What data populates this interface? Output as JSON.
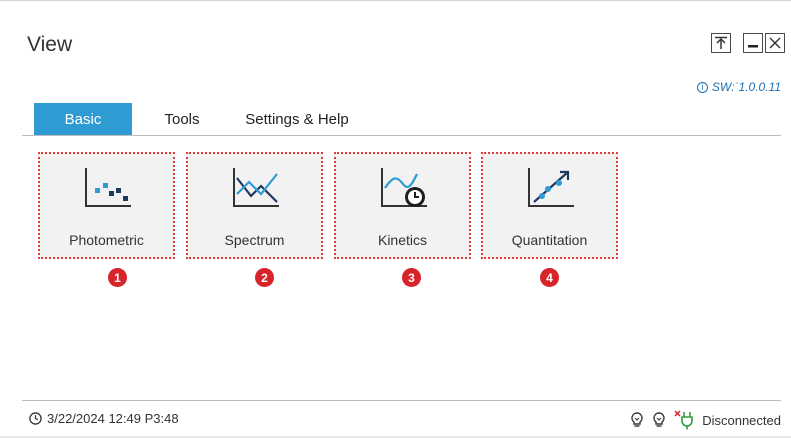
{
  "window": {
    "title": "View"
  },
  "version": {
    "text": "SW:˙1.0.0.11"
  },
  "tabs": [
    {
      "label": "Basic",
      "active": true
    },
    {
      "label": "Tools",
      "active": false
    },
    {
      "label": "Settings & Help",
      "active": false
    }
  ],
  "tiles": [
    {
      "label": "Photometric",
      "icon": "photometric-icon",
      "badge": "1"
    },
    {
      "label": "Spectrum",
      "icon": "spectrum-icon",
      "badge": "2"
    },
    {
      "label": "Kinetics",
      "icon": "kinetics-icon",
      "badge": "3"
    },
    {
      "label": "Quantitation",
      "icon": "quantitation-icon",
      "badge": "4"
    }
  ],
  "status": {
    "datetime": "3/22/2024 12:49 P3:48",
    "connection": "Disconnected"
  },
  "colors": {
    "accent": "#2e9bd3",
    "badge": "#d6242a",
    "highlight_border": "#e03a3a",
    "icon_primary": "#1e3a5f",
    "icon_secondary": "#2e9bd3",
    "disconnected": "#d6242a",
    "plug": "#2f9e44"
  }
}
